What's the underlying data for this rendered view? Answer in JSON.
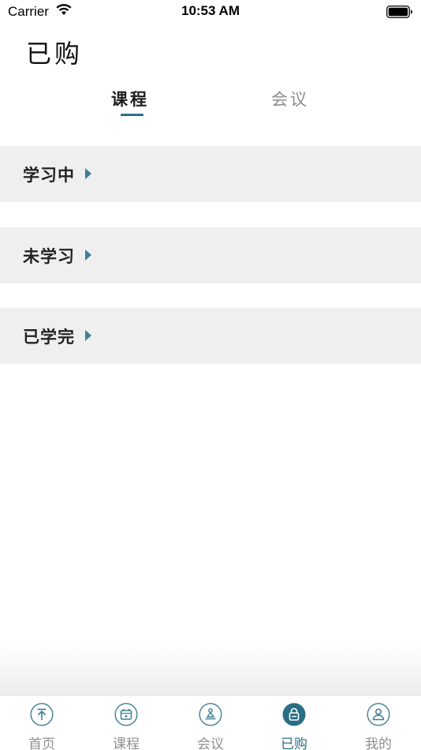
{
  "status_bar": {
    "carrier": "Carrier",
    "time": "10:53 AM"
  },
  "page": {
    "title": "已购"
  },
  "tabs": [
    {
      "label": "课程",
      "active": true
    },
    {
      "label": "会议",
      "active": false
    }
  ],
  "sections": [
    {
      "label": "学习中"
    },
    {
      "label": "未学习"
    },
    {
      "label": "已学完"
    }
  ],
  "tab_bar": {
    "items": [
      {
        "label": "首页",
        "icon": "home-arrow-icon",
        "active": false
      },
      {
        "label": "课程",
        "icon": "calendar-icon",
        "active": false
      },
      {
        "label": "会议",
        "icon": "meeting-icon",
        "active": false
      },
      {
        "label": "已购",
        "icon": "lock-icon",
        "active": true
      },
      {
        "label": "我的",
        "icon": "person-icon",
        "active": false
      }
    ]
  },
  "colors": {
    "accent": "#2b6f86",
    "row_bg": "#efefef",
    "inactive": "#8f8f8f"
  }
}
